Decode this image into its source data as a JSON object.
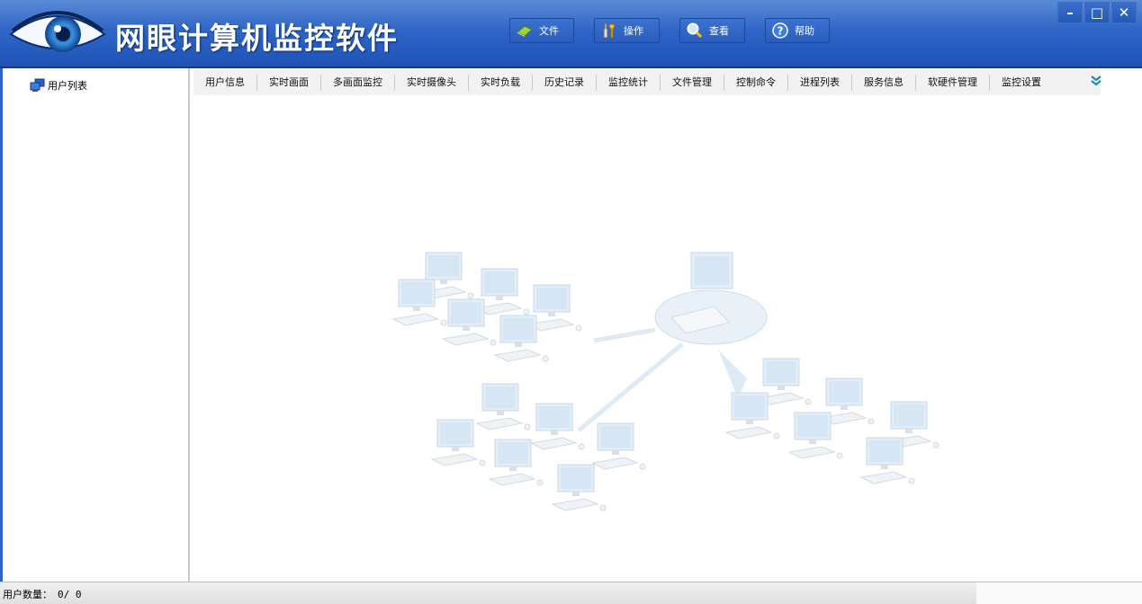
{
  "app": {
    "title": "网眼计算机监控软件"
  },
  "menu": [
    {
      "label": "文件",
      "icon": "eraser-icon"
    },
    {
      "label": "操作",
      "icon": "tools-icon"
    },
    {
      "label": "查看",
      "icon": "magnifier-icon"
    },
    {
      "label": "帮助",
      "icon": "help-icon"
    }
  ],
  "window_controls": {
    "minimize": "–",
    "maximize": "□",
    "close": "✕"
  },
  "sidebar": {
    "root_label": "用户列表",
    "root_icon": "users-icon"
  },
  "tabs": [
    "用户信息",
    "实时画面",
    "多画面监控",
    "实时摄像头",
    "实时负载",
    "历史记录",
    "监控统计",
    "文件管理",
    "控制命令",
    "进程列表",
    "服务信息",
    "软硬件管理",
    "监控设置"
  ],
  "more_icon": "double-chevron-down-icon",
  "status": {
    "label": "用户数量：",
    "value": "0/ 0"
  },
  "colors": {
    "title_bar": "#2f66c6",
    "accent": "#1f53b5",
    "tab_bar": "#f2f2f2"
  }
}
